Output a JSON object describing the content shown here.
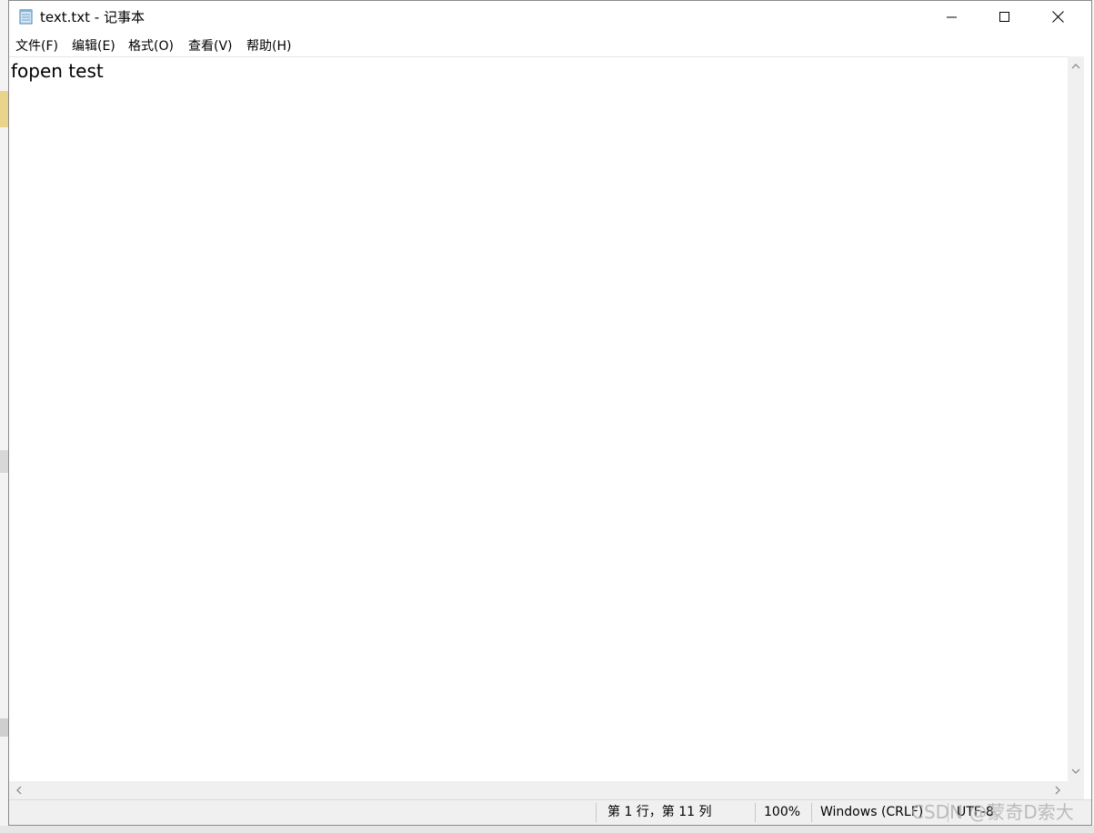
{
  "window": {
    "title": "text.txt - 记事本",
    "app_icon": "notepad-icon",
    "controls": {
      "minimize": "minimize-icon",
      "maximize": "maximize-icon",
      "close": "close-icon"
    }
  },
  "menu": {
    "items": [
      {
        "label": "文件(F)",
        "name": "menu-file"
      },
      {
        "label": "编辑(E)",
        "name": "menu-edit"
      },
      {
        "label": "格式(O)",
        "name": "menu-format"
      },
      {
        "label": "查看(V)",
        "name": "menu-view"
      },
      {
        "label": "帮助(H)",
        "name": "menu-help"
      }
    ]
  },
  "editor": {
    "content": "fopen test"
  },
  "status": {
    "position": "第 1 行，第 11 列",
    "zoom": "100%",
    "line_ending": "Windows (CRLF)",
    "encoding": "UTF-8"
  },
  "watermark": "CSDN @蒙奇D索大",
  "colors": {
    "chrome_bg": "#f0f0f0",
    "editor_bg": "#ffffff",
    "border": "#8a8a8a"
  }
}
